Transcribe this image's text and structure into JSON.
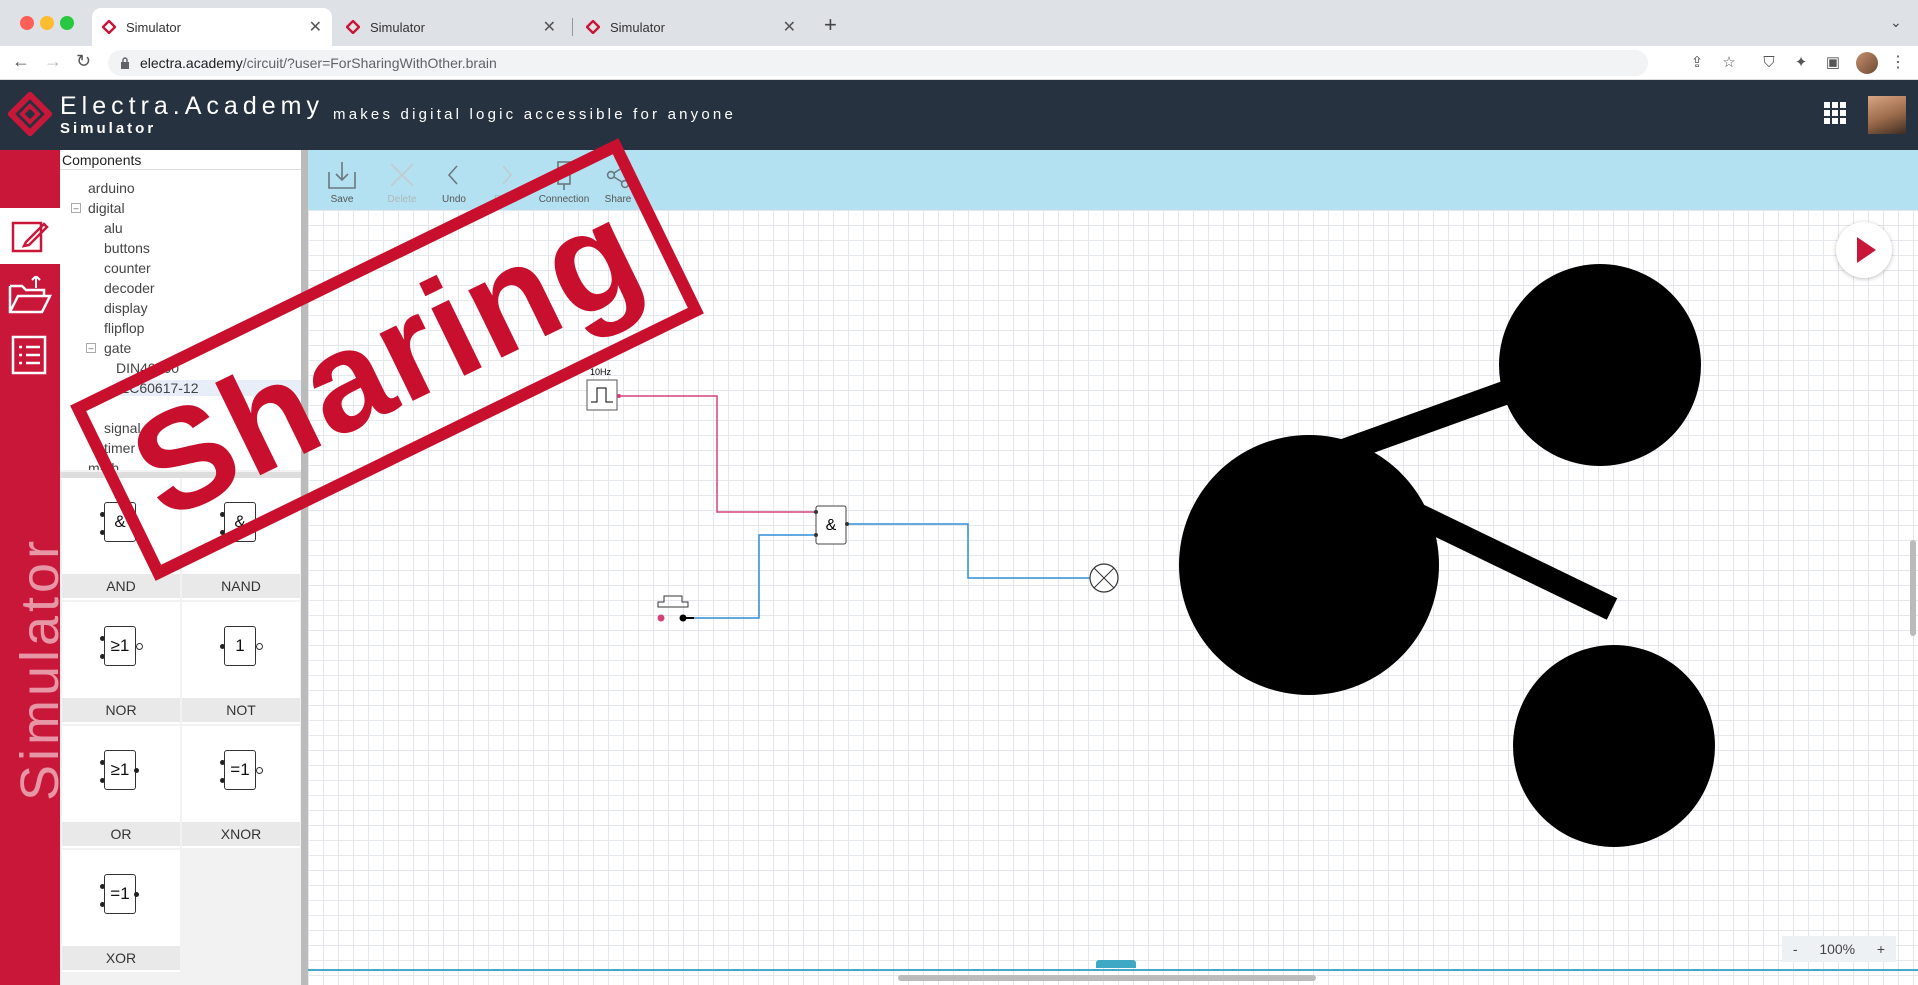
{
  "browser": {
    "tabs": [
      {
        "title": "Simulator",
        "active": true
      },
      {
        "title": "Simulator",
        "active": false
      },
      {
        "title": "Simulator",
        "active": false
      }
    ],
    "url_host": "electra.academy",
    "url_path": "/circuit/?user=ForSharingWithOther.brain",
    "traffic_lights": [
      "#ff5f57",
      "#febc2e",
      "#28c840"
    ]
  },
  "app": {
    "brand": "Electra.Academy",
    "brand_sub": "Simulator",
    "tagline": "makes digital logic accessible for anyone",
    "rail_text": "Simulator",
    "accent_color": "#c9173a",
    "header_color": "#26323f"
  },
  "components": {
    "header": "Components",
    "tree": [
      {
        "label": "arduino"
      },
      {
        "label": "digital"
      },
      {
        "label": "alu"
      },
      {
        "label": "buttons"
      },
      {
        "label": "counter"
      },
      {
        "label": "decoder"
      },
      {
        "label": "display"
      },
      {
        "label": "flipflop"
      },
      {
        "label": "gate"
      },
      {
        "label": "DIN40700"
      },
      {
        "label": "IEC60617-12"
      },
      {
        "label": "signal"
      },
      {
        "label": "timer"
      },
      {
        "label": "math"
      }
    ],
    "palette": [
      {
        "symbol": "&",
        "label": "AND"
      },
      {
        "symbol": "&",
        "label": "NAND"
      },
      {
        "symbol": "≥1",
        "label": "NOR"
      },
      {
        "symbol": "1",
        "label": "NOT"
      },
      {
        "symbol": "≥1",
        "label": "OR"
      },
      {
        "symbol": "=1",
        "label": "XNOR"
      },
      {
        "symbol": "=1",
        "label": "XOR"
      }
    ]
  },
  "canvas_toolbar": {
    "save": "Save",
    "delete": "Delete",
    "undo": "Undo",
    "redo": "Redo",
    "connection": "Connection",
    "share": "Share"
  },
  "circuit": {
    "clock_label": "10Hz",
    "and_symbol": "&"
  },
  "stamp": {
    "text": "Sharing"
  },
  "zoom": {
    "minus": "-",
    "value": "100%",
    "plus": "+"
  }
}
